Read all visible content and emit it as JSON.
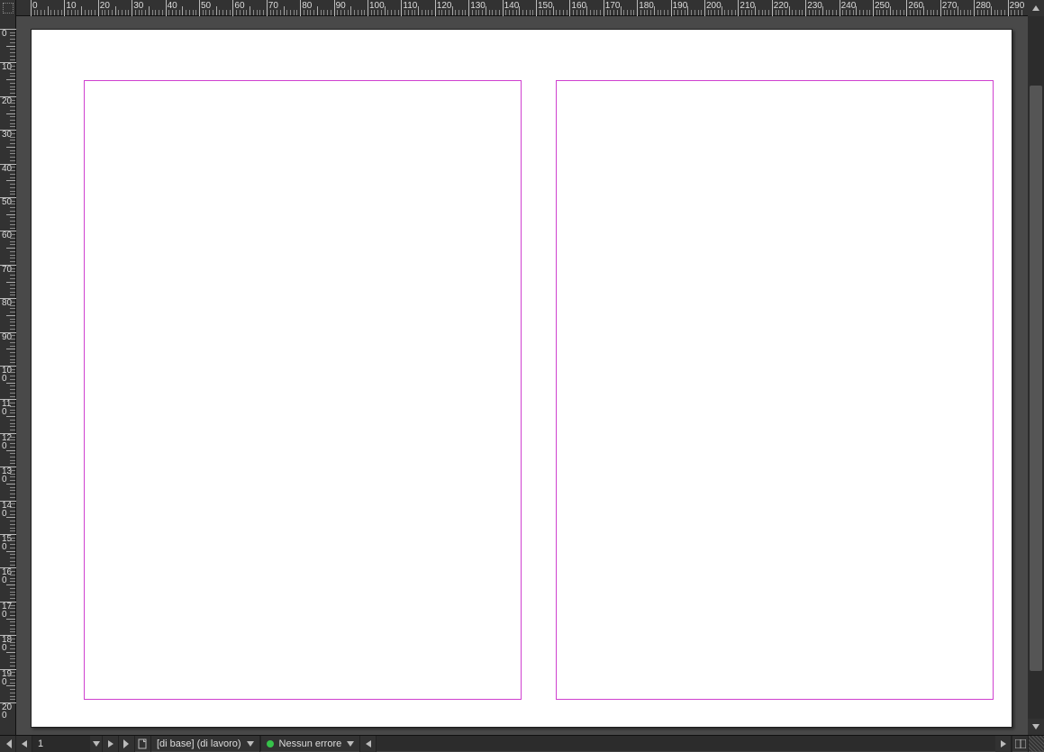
{
  "ruler_h_labels": [
    0,
    10,
    20,
    30,
    40,
    50,
    60,
    70,
    80,
    90,
    100,
    110,
    120,
    130,
    140,
    150,
    160,
    170,
    180,
    190,
    200,
    210,
    220,
    230,
    240,
    250,
    260,
    270,
    280,
    290
  ],
  "ruler_v_labels": [
    0,
    10,
    20,
    30,
    40,
    50,
    60,
    70,
    80,
    90,
    100,
    110,
    120,
    130,
    140,
    150,
    160,
    170,
    180,
    190,
    200
  ],
  "ruler_v_bottom_partial": 2,
  "page_nav": {
    "current_page": "1",
    "spread_label": "[di base] (di lavoro)"
  },
  "preflight": {
    "status_label": "Nessun errore",
    "status_color": "#36c24a"
  },
  "colors": {
    "margin_guide": "#cf40cf",
    "page_bg": "#ffffff",
    "pasteboard": "#494949",
    "chrome": "#323232"
  }
}
